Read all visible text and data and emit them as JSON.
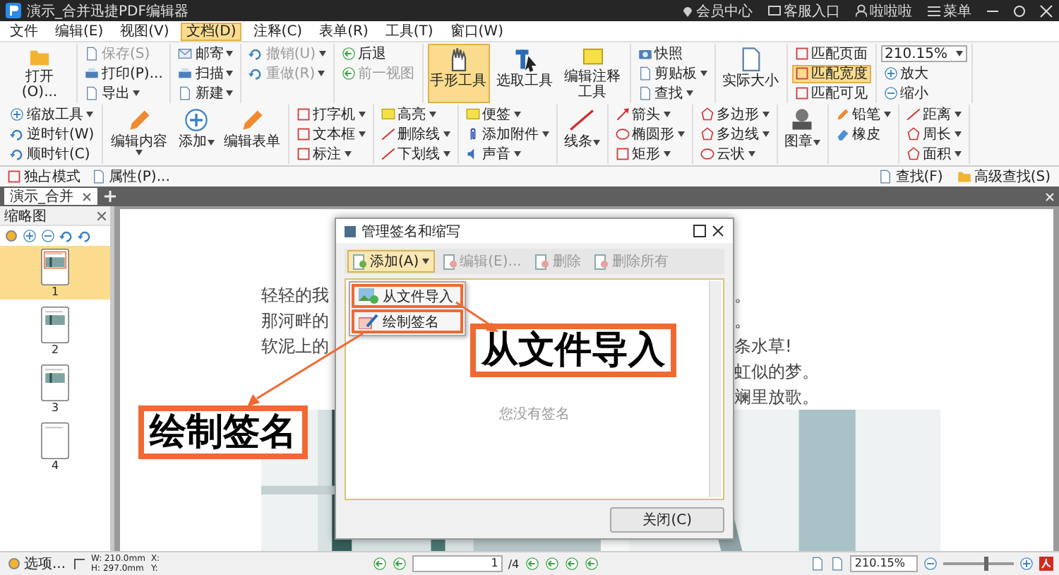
{
  "window": {
    "title": "演示_合并迅捷PDF编辑器",
    "links": [
      {
        "label": "会员中心"
      },
      {
        "label": "客服入口"
      },
      {
        "label": "啦啦啦"
      },
      {
        "label": "菜单"
      }
    ]
  },
  "menu": [
    {
      "label": "文件",
      "selected": false
    },
    {
      "label": "编辑(E)",
      "selected": false
    },
    {
      "label": "视图(V)",
      "selected": false
    },
    {
      "label": "文档(D)",
      "selected": true
    },
    {
      "label": "注释(C)",
      "selected": false
    },
    {
      "label": "表单(R)",
      "selected": false
    },
    {
      "label": "工具(T)",
      "selected": false
    },
    {
      "label": "窗口(W)",
      "selected": false
    }
  ],
  "ribbon": {
    "groups": [
      {
        "items": [
          {
            "label": "打开(O)...",
            "kind": "large",
            "selected": false,
            "disabled": false
          }
        ]
      },
      {
        "items": [
          {
            "label": "保存(S)",
            "kind": "small",
            "selected": false,
            "disabled": true
          },
          {
            "label": "打印(P)...",
            "kind": "small",
            "selected": false,
            "disabled": false
          },
          {
            "label": "导出",
            "kind": "small",
            "selected": false,
            "disabled": false,
            "dropdown": true
          }
        ]
      },
      {
        "items": [
          {
            "label": "邮寄",
            "kind": "small",
            "selected": false,
            "disabled": false,
            "dropdown": true
          },
          {
            "label": "扫描",
            "kind": "small",
            "selected": false,
            "disabled": false,
            "dropdown": true
          },
          {
            "label": "新建",
            "kind": "small",
            "selected": false,
            "disabled": false,
            "dropdown": true
          }
        ]
      },
      {
        "items": [
          {
            "label": "撤销(U)",
            "kind": "small",
            "selected": false,
            "disabled": true,
            "dropdown": true
          },
          {
            "label": "重做(R)",
            "kind": "small",
            "selected": false,
            "disabled": true,
            "dropdown": true
          }
        ]
      },
      {
        "items": [
          {
            "label": "后退",
            "kind": "small",
            "selected": false,
            "disabled": false
          },
          {
            "label": "前一视图",
            "kind": "small",
            "selected": false,
            "disabled": true
          }
        ]
      },
      {
        "items": [
          {
            "label": "手形工具",
            "kind": "large",
            "selected": true,
            "disabled": false
          },
          {
            "label": "选取工具",
            "kind": "large",
            "selected": false,
            "disabled": false
          },
          {
            "label": "编辑注释工具",
            "kind": "large",
            "selected": false,
            "disabled": false
          }
        ]
      },
      {
        "items": [
          {
            "label": "快照",
            "kind": "small",
            "selected": false,
            "disabled": false
          },
          {
            "label": "剪贴板",
            "kind": "small",
            "selected": false,
            "disabled": false,
            "dropdown": true
          },
          {
            "label": "查找",
            "kind": "small",
            "selected": false,
            "disabled": false,
            "dropdown": true
          }
        ]
      },
      {
        "items": [
          {
            "label": "实际大小",
            "kind": "large",
            "selected": false,
            "disabled": false
          }
        ]
      },
      {
        "items": [
          {
            "label": "匹配页面",
            "kind": "small",
            "selected": false,
            "disabled": false
          },
          {
            "label": "匹配宽度",
            "kind": "small",
            "selected": true,
            "disabled": false
          },
          {
            "label": "匹配可见",
            "kind": "small",
            "selected": false,
            "disabled": false
          }
        ]
      },
      {
        "items": [
          {
            "label": "210.15%",
            "kind": "select",
            "selected": false,
            "disabled": false
          },
          {
            "label": "放大",
            "kind": "small",
            "selected": false,
            "disabled": false
          },
          {
            "label": "缩小",
            "kind": "small",
            "selected": false,
            "disabled": false
          }
        ]
      },
      {
        "items": [
          {
            "label": "缩放工具",
            "kind": "small",
            "selected": false,
            "disabled": false,
            "dropdown": true
          },
          {
            "label": "逆时针(W)",
            "kind": "small",
            "selected": false,
            "disabled": false
          },
          {
            "label": "顺时针(C)",
            "kind": "small",
            "selected": false,
            "disabled": false
          }
        ]
      },
      {
        "items": [
          {
            "label": "编辑内容",
            "kind": "large",
            "selected": false,
            "disabled": false,
            "dropdown": true
          },
          {
            "label": "添加",
            "kind": "large",
            "selected": false,
            "disabled": false,
            "dropdown": true
          },
          {
            "label": "编辑表单",
            "kind": "large",
            "selected": false,
            "disabled": false
          }
        ]
      },
      {
        "items": [
          {
            "label": "打字机",
            "kind": "small",
            "selected": false,
            "disabled": false,
            "dropdown": true
          },
          {
            "label": "文本框",
            "kind": "small",
            "selected": false,
            "disabled": false,
            "dropdown": true
          },
          {
            "label": "标注",
            "kind": "small",
            "selected": false,
            "disabled": false,
            "dropdown": true
          }
        ]
      },
      {
        "items": [
          {
            "label": "高亮",
            "kind": "small",
            "selected": false,
            "disabled": false,
            "dropdown": true
          },
          {
            "label": "删除线",
            "kind": "small",
            "selected": false,
            "disabled": false,
            "dropdown": true
          },
          {
            "label": "下划线",
            "kind": "small",
            "selected": false,
            "disabled": false,
            "dropdown": true
          }
        ]
      },
      {
        "items": [
          {
            "label": "便签",
            "kind": "small",
            "selected": false,
            "disabled": false,
            "dropdown": true
          },
          {
            "label": "添加附件",
            "kind": "small",
            "selected": false,
            "disabled": false,
            "dropdown": true
          },
          {
            "label": "声音",
            "kind": "small",
            "selected": false,
            "disabled": false,
            "dropdown": true
          }
        ]
      },
      {
        "items": [
          {
            "label": "线条",
            "kind": "large",
            "selected": false,
            "disabled": false,
            "dropdown": true
          }
        ]
      },
      {
        "items": [
          {
            "label": "箭头",
            "kind": "small",
            "selected": false,
            "disabled": false,
            "dropdown": true
          },
          {
            "label": "椭圆形",
            "kind": "small",
            "selected": false,
            "disabled": false,
            "dropdown": true
          },
          {
            "label": "矩形",
            "kind": "small",
            "selected": false,
            "disabled": false,
            "dropdown": true
          }
        ]
      },
      {
        "items": [
          {
            "label": "多边形",
            "kind": "small",
            "selected": false,
            "disabled": false,
            "dropdown": true
          },
          {
            "label": "多边线",
            "kind": "small",
            "selected": false,
            "disabled": false,
            "dropdown": true
          },
          {
            "label": "云状",
            "kind": "small",
            "selected": false,
            "disabled": false,
            "dropdown": true
          }
        ]
      },
      {
        "items": [
          {
            "label": "图章",
            "kind": "large",
            "selected": false,
            "disabled": false,
            "dropdown": true
          }
        ]
      },
      {
        "items": [
          {
            "label": "铅笔",
            "kind": "small",
            "selected": false,
            "disabled": false,
            "dropdown": true
          },
          {
            "label": "橡皮",
            "kind": "small",
            "selected": false,
            "disabled": false
          }
        ]
      },
      {
        "items": [
          {
            "label": "距离",
            "kind": "small",
            "selected": false,
            "disabled": false,
            "dropdown": true
          },
          {
            "label": "周长",
            "kind": "small",
            "selected": false,
            "disabled": false,
            "dropdown": true
          },
          {
            "label": "面积",
            "kind": "small",
            "selected": false,
            "disabled": false,
            "dropdown": true
          }
        ]
      },
      {
        "items": [
          {
            "label": "查找(F)",
            "kind": "small",
            "selected": false,
            "disabled": false
          },
          {
            "label": "高级查找(S)",
            "kind": "small",
            "selected": false,
            "disabled": false
          }
        ]
      }
    ]
  },
  "quick_bar": [
    {
      "label": "独占模式"
    },
    {
      "label": "属性(P)..."
    }
  ],
  "tabs": [
    {
      "label": "演示_合并",
      "selected": true
    }
  ],
  "thumbnails": {
    "title": "缩略图",
    "pages": [
      {
        "label": "1",
        "selected": true
      },
      {
        "label": "2",
        "selected": false
      },
      {
        "label": "3",
        "selected": false
      },
      {
        "label": "4",
        "selected": false
      }
    ]
  },
  "document": {
    "left_lines": [
      "轻轻的我",
      "那河畔的",
      "软泥上的"
    ],
    "right_lines": [
      "。",
      "。",
      "条水草!",
      "虹似的梦。",
      "斓里放歌。"
    ],
    "photo": {
      "kind": "picture"
    }
  },
  "dialog": {
    "title": "管理签名和缩写",
    "toolbar": [
      {
        "label": "添加(A)",
        "selected": true,
        "disabled": false,
        "dropdown": true
      },
      {
        "label": "编辑(E)...",
        "selected": false,
        "disabled": true
      },
      {
        "label": "删除",
        "selected": false,
        "disabled": true
      },
      {
        "label": "删除所有",
        "selected": false,
        "disabled": true
      }
    ],
    "menu": [
      {
        "label": "从文件导入",
        "annotated": true
      },
      {
        "label": "绘制签名",
        "annotated": true
      }
    ],
    "empty_text": "您没有签名",
    "button": "关闭(C)"
  },
  "callouts": [
    {
      "text": "从文件导入"
    },
    {
      "text": "绘制签名"
    }
  ],
  "status_bar": {
    "options": "选项...",
    "width": "W: 210.0mm",
    "height": "H: 297.0mm",
    "x": "X:",
    "y": "Y:",
    "page": "1",
    "page_total": "/4",
    "zoom": "210.15%",
    "zoom_level": {
      "level": 0.6
    }
  }
}
